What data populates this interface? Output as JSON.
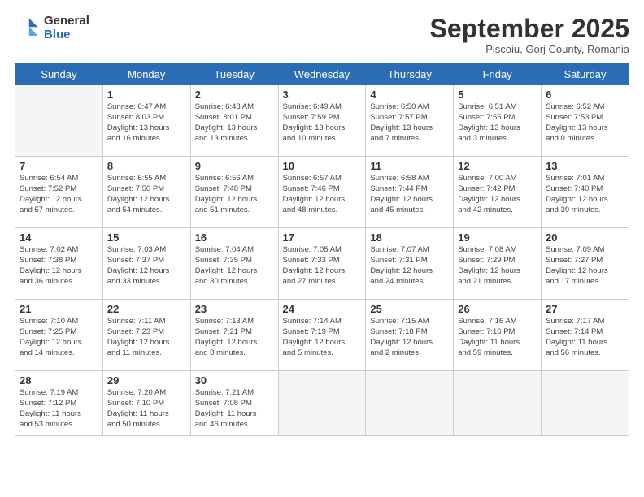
{
  "logo": {
    "general": "General",
    "blue": "Blue"
  },
  "title": "September 2025",
  "location": "Piscoiu, Gorj County, Romania",
  "weekdays": [
    "Sunday",
    "Monday",
    "Tuesday",
    "Wednesday",
    "Thursday",
    "Friday",
    "Saturday"
  ],
  "weeks": [
    [
      {
        "day": "",
        "info": ""
      },
      {
        "day": "1",
        "info": "Sunrise: 6:47 AM\nSunset: 8:03 PM\nDaylight: 13 hours\nand 16 minutes."
      },
      {
        "day": "2",
        "info": "Sunrise: 6:48 AM\nSunset: 8:01 PM\nDaylight: 13 hours\nand 13 minutes."
      },
      {
        "day": "3",
        "info": "Sunrise: 6:49 AM\nSunset: 7:59 PM\nDaylight: 13 hours\nand 10 minutes."
      },
      {
        "day": "4",
        "info": "Sunrise: 6:50 AM\nSunset: 7:57 PM\nDaylight: 13 hours\nand 7 minutes."
      },
      {
        "day": "5",
        "info": "Sunrise: 6:51 AM\nSunset: 7:55 PM\nDaylight: 13 hours\nand 3 minutes."
      },
      {
        "day": "6",
        "info": "Sunrise: 6:52 AM\nSunset: 7:53 PM\nDaylight: 13 hours\nand 0 minutes."
      }
    ],
    [
      {
        "day": "7",
        "info": "Sunrise: 6:54 AM\nSunset: 7:52 PM\nDaylight: 12 hours\nand 57 minutes."
      },
      {
        "day": "8",
        "info": "Sunrise: 6:55 AM\nSunset: 7:50 PM\nDaylight: 12 hours\nand 54 minutes."
      },
      {
        "day": "9",
        "info": "Sunrise: 6:56 AM\nSunset: 7:48 PM\nDaylight: 12 hours\nand 51 minutes."
      },
      {
        "day": "10",
        "info": "Sunrise: 6:57 AM\nSunset: 7:46 PM\nDaylight: 12 hours\nand 48 minutes."
      },
      {
        "day": "11",
        "info": "Sunrise: 6:58 AM\nSunset: 7:44 PM\nDaylight: 12 hours\nand 45 minutes."
      },
      {
        "day": "12",
        "info": "Sunrise: 7:00 AM\nSunset: 7:42 PM\nDaylight: 12 hours\nand 42 minutes."
      },
      {
        "day": "13",
        "info": "Sunrise: 7:01 AM\nSunset: 7:40 PM\nDaylight: 12 hours\nand 39 minutes."
      }
    ],
    [
      {
        "day": "14",
        "info": "Sunrise: 7:02 AM\nSunset: 7:38 PM\nDaylight: 12 hours\nand 36 minutes."
      },
      {
        "day": "15",
        "info": "Sunrise: 7:03 AM\nSunset: 7:37 PM\nDaylight: 12 hours\nand 33 minutes."
      },
      {
        "day": "16",
        "info": "Sunrise: 7:04 AM\nSunset: 7:35 PM\nDaylight: 12 hours\nand 30 minutes."
      },
      {
        "day": "17",
        "info": "Sunrise: 7:05 AM\nSunset: 7:33 PM\nDaylight: 12 hours\nand 27 minutes."
      },
      {
        "day": "18",
        "info": "Sunrise: 7:07 AM\nSunset: 7:31 PM\nDaylight: 12 hours\nand 24 minutes."
      },
      {
        "day": "19",
        "info": "Sunrise: 7:08 AM\nSunset: 7:29 PM\nDaylight: 12 hours\nand 21 minutes."
      },
      {
        "day": "20",
        "info": "Sunrise: 7:09 AM\nSunset: 7:27 PM\nDaylight: 12 hours\nand 17 minutes."
      }
    ],
    [
      {
        "day": "21",
        "info": "Sunrise: 7:10 AM\nSunset: 7:25 PM\nDaylight: 12 hours\nand 14 minutes."
      },
      {
        "day": "22",
        "info": "Sunrise: 7:11 AM\nSunset: 7:23 PM\nDaylight: 12 hours\nand 11 minutes."
      },
      {
        "day": "23",
        "info": "Sunrise: 7:13 AM\nSunset: 7:21 PM\nDaylight: 12 hours\nand 8 minutes."
      },
      {
        "day": "24",
        "info": "Sunrise: 7:14 AM\nSunset: 7:19 PM\nDaylight: 12 hours\nand 5 minutes."
      },
      {
        "day": "25",
        "info": "Sunrise: 7:15 AM\nSunset: 7:18 PM\nDaylight: 12 hours\nand 2 minutes."
      },
      {
        "day": "26",
        "info": "Sunrise: 7:16 AM\nSunset: 7:16 PM\nDaylight: 11 hours\nand 59 minutes."
      },
      {
        "day": "27",
        "info": "Sunrise: 7:17 AM\nSunset: 7:14 PM\nDaylight: 11 hours\nand 56 minutes."
      }
    ],
    [
      {
        "day": "28",
        "info": "Sunrise: 7:19 AM\nSunset: 7:12 PM\nDaylight: 11 hours\nand 53 minutes."
      },
      {
        "day": "29",
        "info": "Sunrise: 7:20 AM\nSunset: 7:10 PM\nDaylight: 11 hours\nand 50 minutes."
      },
      {
        "day": "30",
        "info": "Sunrise: 7:21 AM\nSunset: 7:08 PM\nDaylight: 11 hours\nand 46 minutes."
      },
      {
        "day": "",
        "info": ""
      },
      {
        "day": "",
        "info": ""
      },
      {
        "day": "",
        "info": ""
      },
      {
        "day": "",
        "info": ""
      }
    ]
  ]
}
